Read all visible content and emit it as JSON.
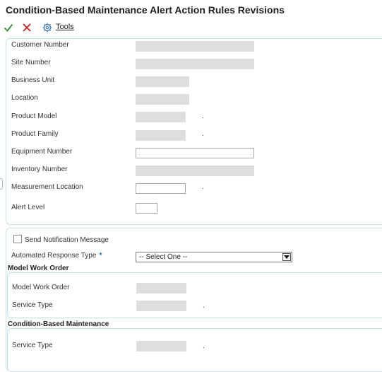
{
  "window": {
    "title": "Condition-Based Maintenance Alert Action Rules Revisions"
  },
  "toolbar": {
    "ok_icon": "check-icon",
    "cancel_icon": "x-icon",
    "tools_icon": "gear-icon",
    "tools_label": "Tools",
    "colors": {
      "ok": "#2e8b2e",
      "cancel": "#d42020",
      "tools": "#4a7fb0"
    }
  },
  "header_form": {
    "customer_number_label": "Customer Number",
    "site_number_label": "Site Number",
    "business_unit_label": "Business Unit",
    "location_label": "Location",
    "product_model_label": "Product Model",
    "product_family_label": "Product Family",
    "equipment_number_label": "Equipment Number",
    "equipment_number_value": "",
    "inventory_number_label": "Inventory Number",
    "measurement_location_label": "Measurement Location",
    "measurement_location_value": "",
    "alert_level_label": "Alert Level",
    "alert_level_value": "",
    "dot": "."
  },
  "detail_form": {
    "send_notification_label": "Send Notification Message",
    "send_notification_checked": false,
    "automated_response_label": "Automated Response Type",
    "required_mark": "*",
    "automated_response_value": "-- Select One --",
    "model_work_order_header": "Model Work Order",
    "model_work_order_label": "Model Work Order",
    "service_type_label": "Service Type",
    "cbm_header": "Condition-Based Maintenance",
    "cbm_service_type_label": "Service Type",
    "dot": "."
  }
}
